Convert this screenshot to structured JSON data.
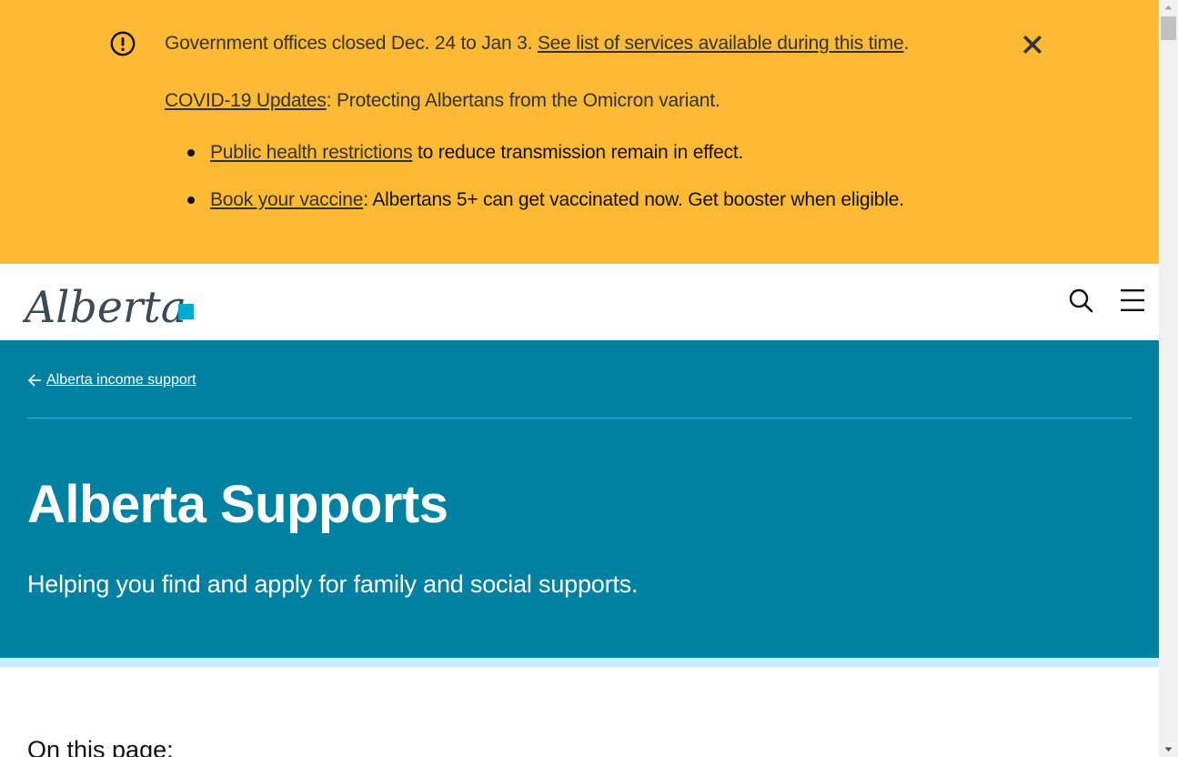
{
  "alert": {
    "line1_text": "Government offices closed Dec. 24 to Jan 3. ",
    "line1_link": "See list of services available during this time",
    "line1_end": ".",
    "line2_link": "COVID-19 Updates",
    "line2_text": ": Protecting Albertans from the Omicron variant.",
    "bullets": [
      {
        "link": "Public health restrictions",
        "text": " to reduce transmission remain in effect."
      },
      {
        "link": "Book your vaccine",
        "text": ": Albertans 5+ can get vaccinated now. Get booster when eligible."
      }
    ],
    "background": "#feba35"
  },
  "header": {
    "logo_text": "Alberta",
    "logo_accent": "#00aad2"
  },
  "hero": {
    "back_link": "Alberta income support",
    "title": "Alberta Supports",
    "subtitle": "Helping you find and apply for family and social supports.",
    "background": "#0081a2",
    "stripe_color": "#c8eefa"
  },
  "main": {
    "toc_heading": "On this page:"
  }
}
